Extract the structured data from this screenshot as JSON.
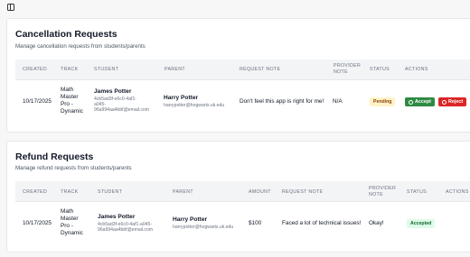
{
  "topbar": {
    "toggle_icon": "sidebar-toggle-icon"
  },
  "cancellation": {
    "title": "Cancellation Requests",
    "description": "Manage cancellation requests from students/parents",
    "columns": [
      "CREATED",
      "TRACK",
      "STUDENT",
      "PARENT",
      "REQUEST NOTE",
      "PROVIDER NOTE",
      "STATUS",
      "ACTIONS"
    ],
    "rows": [
      {
        "created": "10/17/2025",
        "track": [
          "Math",
          "Master",
          "Pro -",
          "Dynamic"
        ],
        "student_name": "James Potter",
        "student_id": [
          "4cb5ad3f-e6c0-4af1-",
          "a045-",
          "96a994aa4bbf",
          "email.com"
        ],
        "student_email_prefix": "96a994aa4bbf@email.com",
        "parent_name": "Harry Potter",
        "parent_email": "harrypotter@hogwarts.uk.edu",
        "request_note": "Don't feel this app is right for me!",
        "provider_note": "N/A",
        "status": "Pending",
        "accept_label": "Accept",
        "reject_label": "Reject"
      }
    ]
  },
  "refund": {
    "title": "Refund Requests",
    "description": "Manage refund requests from students/parents",
    "columns": [
      "CREATED",
      "TRACK",
      "STUDENT",
      "PARENT",
      "AMOUNT",
      "REQUEST NOTE",
      "PROVIDER NOTE",
      "STATUS",
      "ACTIONS"
    ],
    "rows": [
      {
        "created": "10/17/2025",
        "track": [
          "Math",
          "Master",
          "Pro -",
          "Dynamic"
        ],
        "student_name": "James Potter",
        "student_id_1": "4cb5ad3f-e6c0-4af1-a045-",
        "student_id_2": "96a994aa4bbf@email.com",
        "parent_name": "Harry Potter",
        "parent_email": "harrypotter@hogwarts.uk.edu",
        "amount": "$100",
        "request_note": "Faced a lot of technical issues!",
        "provider_note": "Okay!",
        "status": "Accepted"
      }
    ]
  },
  "colors": {
    "accept": "#2f8a43",
    "reject": "#dc2626",
    "pending_bg": "#fef3c7",
    "accepted_bg": "#dcfce7"
  }
}
